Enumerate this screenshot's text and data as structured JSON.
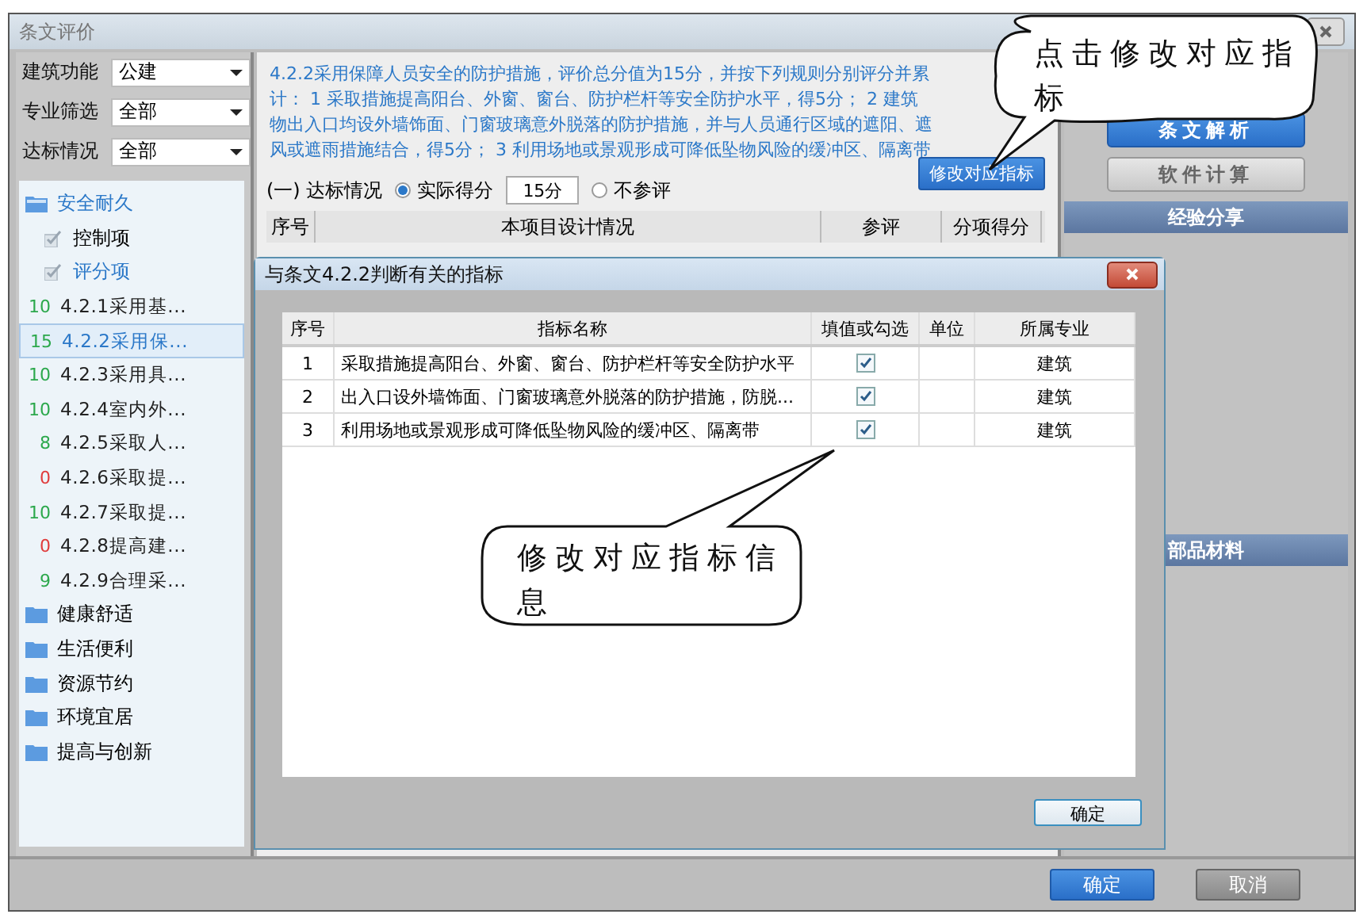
{
  "window": {
    "title": "条文评价"
  },
  "filters": [
    {
      "label": "建筑功能",
      "value": "公建"
    },
    {
      "label": "专业筛选",
      "value": "全部"
    },
    {
      "label": "达标情况",
      "value": "全部"
    }
  ],
  "tree": [
    {
      "label": "安全耐久",
      "expanded": true,
      "children": [
        {
          "label": "控制项",
          "expanded": false
        },
        {
          "label": "评分项",
          "expanded": true,
          "children": [
            {
              "score": "10",
              "label": "4.2.1采用基...",
              "color": "#2ca84c",
              "selected": false
            },
            {
              "score": "15",
              "label": "4.2.2采用保...",
              "color": "#2ca84c",
              "selected": true
            },
            {
              "score": "10",
              "label": "4.2.3采用具...",
              "color": "#2ca84c",
              "selected": false
            },
            {
              "score": "10",
              "label": "4.2.4室内外...",
              "color": "#2ca84c",
              "selected": false
            },
            {
              "score": "8",
              "label": "4.2.5采取人...",
              "color": "#2ca84c",
              "selected": false
            },
            {
              "score": "0",
              "label": "4.2.6采取提...",
              "color": "#e03c3c",
              "selected": false
            },
            {
              "score": "10",
              "label": "4.2.7采取提...",
              "color": "#2ca84c",
              "selected": false
            },
            {
              "score": "0",
              "label": "4.2.8提高建...",
              "color": "#e03c3c",
              "selected": false
            },
            {
              "score": "9",
              "label": "4.2.9合理采...",
              "color": "#2ca84c",
              "selected": false
            }
          ]
        }
      ]
    },
    {
      "label": "健康舒适",
      "expanded": false
    },
    {
      "label": "生活便利",
      "expanded": false
    },
    {
      "label": "资源节约",
      "expanded": false
    },
    {
      "label": "环境宜居",
      "expanded": false
    },
    {
      "label": "提高与创新",
      "expanded": false
    }
  ],
  "description_lines": [
    "4.2.2采用保障人员安全的防护措施，评价总分值为15分，并按下列规则分别评分并累",
    "计： 1 采取措施提高阳台、外窗、窗台、防护栏杆等安全防护水平，得5分； 2 建筑",
    "物出入口均设外墙饰面、门窗玻璃意外脱落的防护措施，并与人员通行区域的遮阳、遮",
    "风或遮雨措施结合，得5分； 3 利用场地或景观形成可降低坠物风险的缓冲区、隔离带"
  ],
  "status": {
    "label": "(一) 达标情况",
    "options": [
      {
        "label": "实际得分",
        "selected": true
      },
      {
        "label": "不参评",
        "selected": false
      }
    ],
    "score": "15分"
  },
  "modify_button": "修改对应指标",
  "main_table": {
    "columns": [
      "序号",
      "本项目设计情况",
      "参评",
      "分项得分"
    ]
  },
  "side_buttons": [
    {
      "label": "条文解析",
      "primary": true
    },
    {
      "label": "软件计算",
      "primary": false
    }
  ],
  "side_sections": [
    "经验分享",
    "部品材料"
  ],
  "footer_buttons": [
    {
      "label": "确定",
      "primary": true
    },
    {
      "label": "取消",
      "primary": false
    }
  ],
  "dialog": {
    "title": "与条文4.2.2判断有关的指标",
    "columns": [
      "序号",
      "指标名称",
      "填值或勾选",
      "单位",
      "所属专业"
    ],
    "rows": [
      {
        "no": "1",
        "name": "采取措施提高阳台、外窗、窗台、防护栏杆等安全防护水平",
        "checked": true,
        "discipline": "建筑"
      },
      {
        "no": "2",
        "name": "出入口设外墙饰面、门窗玻璃意外脱落的防护措施，防脱...",
        "checked": true,
        "discipline": "建筑"
      },
      {
        "no": "3",
        "name": "利用场地或景观形成可降低坠物风险的缓冲区、隔离带",
        "checked": true,
        "discipline": "建筑"
      }
    ],
    "ok": "确定"
  },
  "callouts": [
    {
      "text": "点击修改对应指标"
    },
    {
      "text": "修改对应指标信息"
    }
  ]
}
